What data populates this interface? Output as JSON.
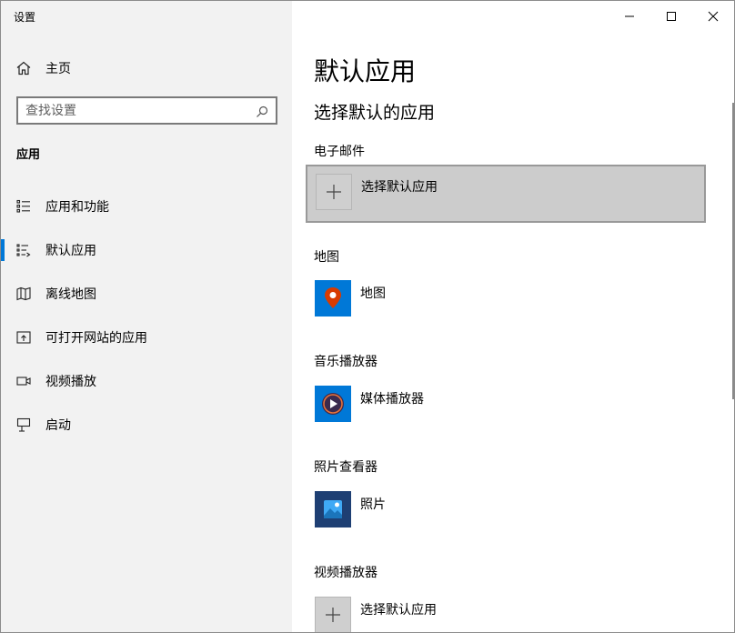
{
  "window": {
    "title": "设置",
    "controls": {
      "minimize": "minimize-icon",
      "maximize": "maximize-icon",
      "close": "close-icon"
    }
  },
  "sidebar": {
    "home_label": "主页",
    "search": {
      "placeholder": "查找设置",
      "value": ""
    },
    "section_title": "应用",
    "items": [
      {
        "label": "应用和功能",
        "icon": "apps-features-icon"
      },
      {
        "label": "默认应用",
        "icon": "default-apps-icon",
        "selected": true
      },
      {
        "label": "离线地图",
        "icon": "offline-maps-icon"
      },
      {
        "label": "可打开网站的应用",
        "icon": "apps-for-websites-icon"
      },
      {
        "label": "视频播放",
        "icon": "video-playback-icon"
      },
      {
        "label": "启动",
        "icon": "startup-icon"
      }
    ]
  },
  "main": {
    "title": "默认应用",
    "subheading": "选择默认的应用",
    "categories": [
      {
        "label": "电子邮件",
        "app_name": "选择默认应用",
        "icon": "plus-icon",
        "selected": true
      },
      {
        "label": "地图",
        "app_name": "地图",
        "icon": "maps-pin-icon"
      },
      {
        "label": "音乐播放器",
        "app_name": "媒体播放器",
        "icon": "media-player-icon"
      },
      {
        "label": "照片查看器",
        "app_name": "照片",
        "icon": "photos-icon"
      },
      {
        "label": "视频播放器",
        "app_name": "选择默认应用",
        "icon": "plus-icon"
      }
    ]
  },
  "colors": {
    "accent": "#0078d7",
    "sidebar_bg": "#f2f2f2",
    "selected_tile_bg": "#cccccc",
    "photos_tile": "#1e3f73",
    "maps_pin": "#d83b01"
  }
}
